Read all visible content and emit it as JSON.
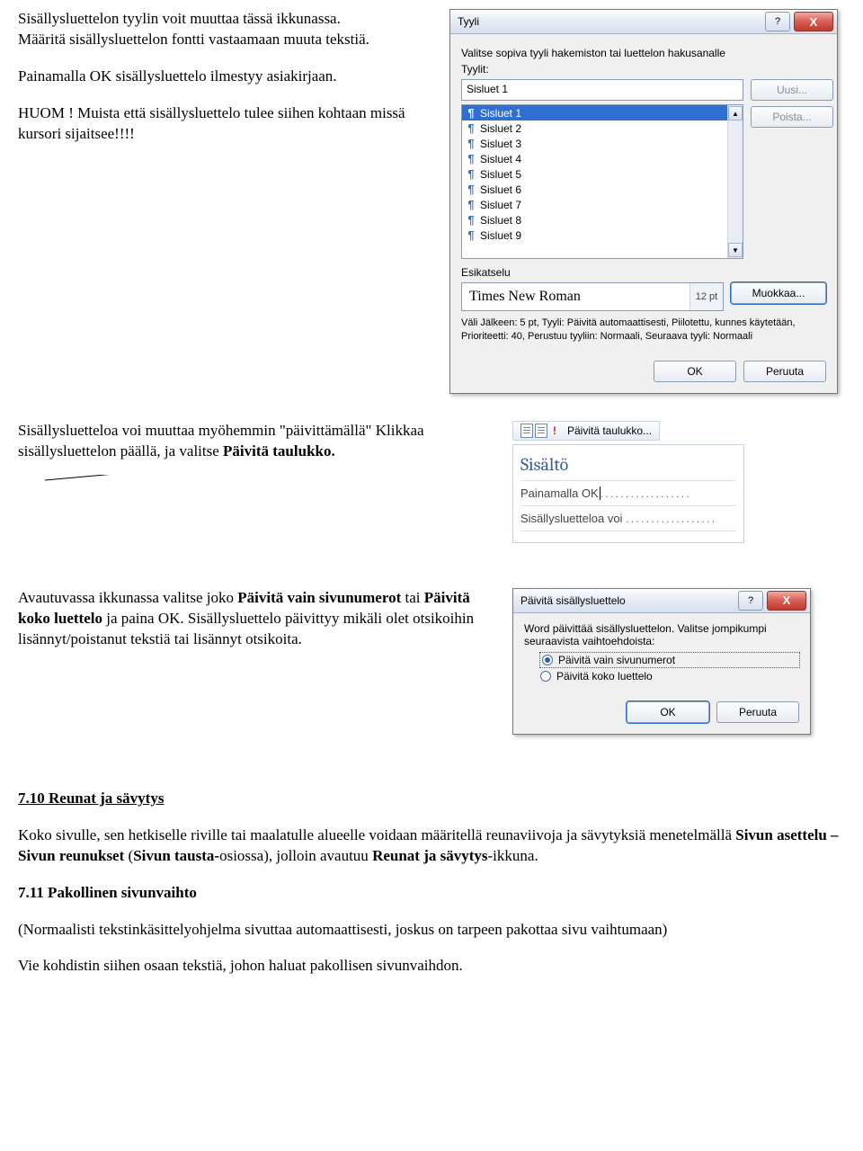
{
  "intro": {
    "p1a": "Sisällysluettelon tyylin voit muuttaa tässä ikkunassa.",
    "p1b": "Määritä sisällysluettelon fontti vastaamaan muuta tekstiä.",
    "p2": "Painamalla OK sisällysluettelo ilmestyy asiakirjaan.",
    "p3a": "HUOM ! ",
    "p3b": "Muista että sisällysluettelo tulee siihen kohtaan missä kursori sijaitsee!!!!"
  },
  "style_dialog": {
    "title": "Tyyli",
    "instruction": "Valitse sopiva tyyli hakemiston tai luettelon hakusanalle",
    "list_label": "Tyylit:",
    "current": "Sisluet 1",
    "items": [
      "Sisluet 1",
      "Sisluet 2",
      "Sisluet 3",
      "Sisluet 4",
      "Sisluet 5",
      "Sisluet 6",
      "Sisluet 7",
      "Sisluet 8",
      "Sisluet 9"
    ],
    "btn_new": "Uusi...",
    "btn_delete": "Poista...",
    "preview_label": "Esikatselu",
    "preview_font": "Times New Roman",
    "preview_size": "12 pt",
    "btn_modify": "Muokkaa...",
    "description": "Väli Jälkeen:  5 pt, Tyyli: Päivitä automaattisesti, Piilotettu, kunnes käytetään, Prioriteetti: 40, Perustuu tyyliin: Normaali, Seuraava tyyli: Normaali",
    "ok": "OK",
    "cancel": "Peruuta"
  },
  "update_text": {
    "p1_pre": "Sisällysluetteloa voi muuttaa myöhemmin \"päivittämällä\" Klikkaa sisällysluettelon päällä, ja valitse ",
    "p1_bold": "Päivitä taulukko."
  },
  "mini": {
    "ribbon": "Päivitä taulukko...",
    "heading": "Sisältö",
    "line1": "Painamalla OK",
    "line2": "Sisällysluetteloa voi"
  },
  "update_para": {
    "pre": "Avautuvassa ikkunassa valitse joko ",
    "b1": "Päivitä vain sivunumerot",
    "mid1": " tai ",
    "b2": "Päivitä koko luettelo",
    "mid2": " ja paina OK. Sisällysluettelo päivittyy mikäli olet otsikoihin lisännyt/poistanut tekstiä tai lisännyt otsikoita."
  },
  "update_dialog": {
    "title": "Päivitä sisällysluettelo",
    "msg": "Word päivittää sisällysluettelon. Valitse jompikumpi seuraavista vaihtoehdoista:",
    "opt1": "Päivitä vain sivunumerot",
    "opt2": "Päivitä koko luettelo",
    "ok": "OK",
    "cancel": "Peruuta"
  },
  "sec710": {
    "title": "7.10 Reunat ja sävytys",
    "body_pre": "Koko sivulle, sen hetkiselle riville tai maalatulle alueelle voidaan määritellä reunaviivoja ja sävytyksiä menetelmällä ",
    "b1": "Sivun asettelu – Sivun reunukset ",
    "mid": "(",
    "b2": "Sivun tausta-",
    "post": "osiossa), jolloin avautuu ",
    "b3": "Reunat ja sävytys",
    "post2": "-ikkuna."
  },
  "sec711": {
    "title": "7.11 Pakollinen sivunvaihto",
    "p1": "(Normaalisti tekstinkäsittelyohjelma sivuttaa automaattisesti, joskus on tarpeen pakottaa sivu vaihtumaan)",
    "p2": "Vie kohdistin siihen osaan tekstiä, johon haluat pakollisen sivunvaihdon."
  }
}
